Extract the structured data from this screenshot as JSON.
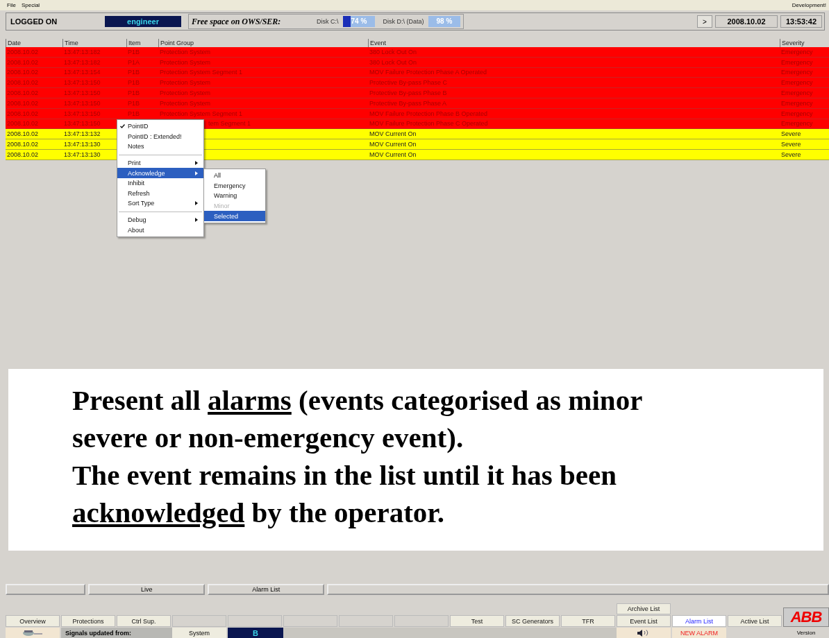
{
  "menu_bar": {
    "items": [
      "File",
      "Special"
    ],
    "right_text": "Development!"
  },
  "status": {
    "login": "LOGGED ON",
    "user": "engineer",
    "free_space_label": "Free space on OWS/SER:",
    "disks": [
      {
        "label": "Disk C:\\",
        "reading": "74 %",
        "level": 0.74
      },
      {
        "label": "Disk D:\\ (Data)",
        "reading": "98 %",
        "level": 0.98
      }
    ],
    "nav": ">",
    "date": "2008.10.02",
    "time": "13:53:42"
  },
  "table": {
    "columns": [
      "Date",
      "Time",
      "Item",
      "Point Group",
      "Event",
      "Severity"
    ],
    "rows": [
      {
        "kind": "emergency",
        "date": "2008.10.02",
        "time": "13:47:13:182",
        "item": "P1B",
        "point_group": "Protection System",
        "event": "380 Lock Out On",
        "severity": "Emergency"
      },
      {
        "kind": "emergency",
        "date": "2008.10.02",
        "time": "13:47:13:182",
        "item": "P1A",
        "point_group": "Protection System",
        "event": "380 Lock Out On",
        "severity": "Emergency"
      },
      {
        "kind": "emergency",
        "date": "2008.10.02",
        "time": "13:47:13:154",
        "item": "P1B",
        "point_group": "Protection System Segment 1",
        "event": "MOV Failure Protection Phase A Operated",
        "severity": "Emergency"
      },
      {
        "kind": "emergency",
        "date": "2008.10.02",
        "time": "13:47:13:150",
        "item": "P1B",
        "point_group": "Protection System",
        "event": "Protective By-pass Phase C",
        "severity": "Emergency"
      },
      {
        "kind": "emergency",
        "date": "2008.10.02",
        "time": "13:47:13:150",
        "item": "P1B",
        "point_group": "Protection System",
        "event": "Protective By-pass Phase B",
        "severity": "Emergency"
      },
      {
        "kind": "emergency",
        "date": "2008.10.02",
        "time": "13:47:13:150",
        "item": "P1B",
        "point_group": "Protection System",
        "event": "Protective By-pass Phase A",
        "severity": "Emergency"
      },
      {
        "kind": "emergency",
        "date": "2008.10.02",
        "time": "13:47:13:150",
        "item": "P1B",
        "point_group": "Protection System Segment 1",
        "event": "MOV Failure Protection Phase B Operated",
        "severity": "Emergency"
      },
      {
        "kind": "emergency",
        "date": "2008.10.02",
        "time": "13:47:13:150",
        "point_group": "tem Segment 1",
        "event": "MOV Failure Protection Phase C Operated",
        "severity": "Emergency"
      },
      {
        "kind": "severe",
        "date": "2008.10.02",
        "time": "13:47:13:132",
        "event": "MOV Current On",
        "severity": "Severe"
      },
      {
        "kind": "severe",
        "date": "2008.10.02",
        "time": "13:47:13:130",
        "event": "MOV Current On",
        "severity": "Severe"
      },
      {
        "kind": "severe",
        "date": "2008.10.02",
        "time": "13:47:13:130",
        "event": "MOV Current On",
        "severity": "Severe"
      }
    ]
  },
  "context_menu": {
    "items": [
      {
        "kind": "item",
        "label": "PointID",
        "checked": true,
        "submenu": false,
        "selected": false
      },
      {
        "kind": "item",
        "label": "PointID : Extended!",
        "checked": false,
        "submenu": false,
        "selected": false
      },
      {
        "kind": "item",
        "label": "Notes",
        "checked": false,
        "submenu": false,
        "selected": false
      },
      {
        "kind": "separator"
      },
      {
        "kind": "item",
        "label": "Print",
        "checked": false,
        "submenu": true,
        "selected": false
      },
      {
        "kind": "item",
        "label": "Acknowledge",
        "checked": false,
        "submenu": true,
        "selected": true
      },
      {
        "kind": "item",
        "label": "Inhibit",
        "checked": false,
        "submenu": false,
        "selected": false
      },
      {
        "kind": "item",
        "label": "Refresh",
        "checked": false,
        "submenu": false,
        "selected": false
      },
      {
        "kind": "item",
        "label": "Sort Type",
        "checked": false,
        "submenu": true,
        "selected": false
      },
      {
        "kind": "separator"
      },
      {
        "kind": "item",
        "label": "Debug",
        "checked": false,
        "submenu": true,
        "selected": false
      },
      {
        "kind": "item",
        "label": "About",
        "checked": false,
        "submenu": false,
        "selected": false
      }
    ],
    "submenu": [
      {
        "label": "All",
        "disabled": false,
        "selected": false
      },
      {
        "label": "Emergency",
        "disabled": false,
        "selected": false
      },
      {
        "label": "Warning",
        "disabled": false,
        "selected": false
      },
      {
        "label": "Minor",
        "disabled": true,
        "selected": false
      },
      {
        "label": "Selected",
        "disabled": false,
        "selected": true
      }
    ]
  },
  "annotation": {
    "paragraphs": [
      [
        {
          "text": "Present all ",
          "underlined": false
        },
        {
          "text": "alarms",
          "underlined": true
        },
        {
          "text": " (events categorised as minor severe or non-emergency event).",
          "underlined": false
        }
      ],
      [
        {
          "text": "The event remains in the list until it has been ",
          "underlined": false
        },
        {
          "text": "acknowledged",
          "underlined": true
        },
        {
          "text": " by the operator.",
          "underlined": false
        }
      ]
    ]
  },
  "tab_strip": [
    {
      "kind": "blank"
    },
    {
      "kind": "tab",
      "label": "Live"
    },
    {
      "kind": "tab",
      "label": "Alarm List"
    },
    {
      "kind": "blank"
    }
  ],
  "bottom": {
    "nav_buttons": [
      {
        "kind": "button",
        "label": "Overview"
      },
      {
        "kind": "button",
        "label": "Protections"
      },
      {
        "kind": "button",
        "label": "Ctrl Sup."
      },
      {
        "kind": "blank"
      },
      {
        "kind": "blank"
      },
      {
        "kind": "blank"
      },
      {
        "kind": "blank"
      },
      {
        "kind": "blank"
      },
      {
        "kind": "button",
        "label": "Test"
      },
      {
        "kind": "button",
        "label": "SC Generators"
      },
      {
        "kind": "button",
        "label": "TFR"
      }
    ],
    "archive_list": "Archive List",
    "list_buttons": [
      {
        "label": "Event List",
        "selected": false
      },
      {
        "label": "Alarm List",
        "selected": true
      },
      {
        "label": "Active List",
        "selected": false
      }
    ],
    "logo": "ABB",
    "version": "Version",
    "signals_label": "Signals updated from:",
    "source": "System",
    "server": "B",
    "new_alarm": "NEW ALARM"
  }
}
